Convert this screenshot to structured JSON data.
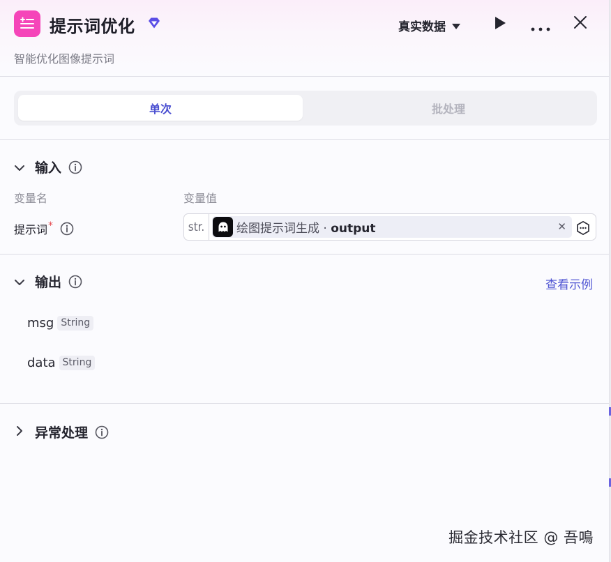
{
  "header": {
    "title": "提示词优化",
    "subtitle": "智能优化图像提示词",
    "data_mode": "真实数据",
    "icon": "list-sparkle-icon",
    "badge_icon": "gem-icon",
    "accent_color": "#f545b9"
  },
  "tabs": [
    {
      "label": "单次",
      "active": true
    },
    {
      "label": "批处理",
      "active": false
    }
  ],
  "input_section": {
    "title": "输入",
    "col_name": "变量名",
    "col_value": "变量值",
    "fields": [
      {
        "name": "提示词",
        "required": "*",
        "type_tag": "str.",
        "ref_source": "绘图提示词生成",
        "ref_separator": " · ",
        "ref_field": "output"
      }
    ]
  },
  "output_section": {
    "title": "输出",
    "example_link": "查看示例",
    "outputs": [
      {
        "name": "msg",
        "type": "String"
      },
      {
        "name": "data",
        "type": "String"
      }
    ]
  },
  "error_section": {
    "title": "异常处理"
  },
  "watermark": "掘金技术社区 @ 吾鳴",
  "colors": {
    "accent_blue": "#4a4fd1",
    "link": "#5056d3",
    "required": "#e5484d"
  }
}
